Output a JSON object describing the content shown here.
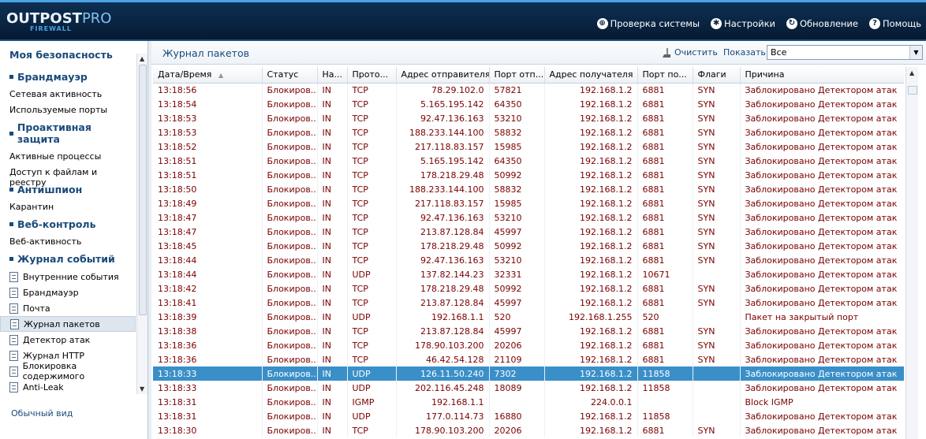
{
  "app": {
    "logo_main": "OUTPOST",
    "logo_pro": "PRO",
    "logo_sub": "FIREWALL"
  },
  "topnav": [
    {
      "label": "Проверка системы",
      "icon": "scan-icon"
    },
    {
      "label": "Настройки",
      "icon": "gear-icon"
    },
    {
      "label": "Обновление",
      "icon": "update-icon"
    },
    {
      "label": "Помощь",
      "icon": "help-icon"
    }
  ],
  "sidebar": {
    "sections": [
      {
        "title": "Моя безопасность",
        "items": []
      },
      {
        "title": "Брандмауэр",
        "items": [
          "Сетевая активность",
          "Используемые порты"
        ]
      },
      {
        "title": "Проактивная защита",
        "items": [
          "Активные процессы",
          "Доступ к файлам и реестру"
        ]
      },
      {
        "title": "Антишпион",
        "items": [
          "Карантин"
        ]
      },
      {
        "title": "Веб-контроль",
        "items": [
          "Веб-активность"
        ]
      },
      {
        "title": "Журнал событий",
        "items": [
          "Внутренние события",
          "Брандмауэр",
          "Почта",
          "Журнал пакетов",
          "Детектор атак",
          "Журнал HTTP",
          "Блокировка содержимого",
          "Anti-Leak"
        ]
      }
    ],
    "normal_view": "Обычный вид"
  },
  "toolbar": {
    "title": "Журнал пакетов",
    "clear": "Очистить",
    "show_label": "Показать:",
    "show_value": "Все"
  },
  "table": {
    "headers": [
      "Дата/Время",
      "Статус",
      "На...",
      "Прото...",
      "Адрес отправителя",
      "Порт отп...",
      "Адрес получателя",
      "Порт по...",
      "Флаги",
      "Причина"
    ],
    "selected_index": 20,
    "rows": [
      [
        "13:18:56",
        "Блокиров...",
        "IN",
        "TCP",
        "78.29.102.0",
        "57821",
        "192.168.1.2",
        "6881",
        "SYN",
        "Заблокировано Детектором атак"
      ],
      [
        "13:18:54",
        "Блокиров...",
        "IN",
        "TCP",
        "5.165.195.142",
        "64350",
        "192.168.1.2",
        "6881",
        "SYN",
        "Заблокировано Детектором атак"
      ],
      [
        "13:18:53",
        "Блокиров...",
        "IN",
        "TCP",
        "92.47.136.163",
        "53210",
        "192.168.1.2",
        "6881",
        "SYN",
        "Заблокировано Детектором атак"
      ],
      [
        "13:18:53",
        "Блокиров...",
        "IN",
        "TCP",
        "188.233.144.100",
        "58832",
        "192.168.1.2",
        "6881",
        "SYN",
        "Заблокировано Детектором атак"
      ],
      [
        "13:18:52",
        "Блокиров...",
        "IN",
        "TCP",
        "217.118.83.157",
        "15985",
        "192.168.1.2",
        "6881",
        "SYN",
        "Заблокировано Детектором атак"
      ],
      [
        "13:18:51",
        "Блокиров...",
        "IN",
        "TCP",
        "5.165.195.142",
        "64350",
        "192.168.1.2",
        "6881",
        "SYN",
        "Заблокировано Детектором атак"
      ],
      [
        "13:18:51",
        "Блокиров...",
        "IN",
        "TCP",
        "178.218.29.48",
        "50992",
        "192.168.1.2",
        "6881",
        "SYN",
        "Заблокировано Детектором атак"
      ],
      [
        "13:18:50",
        "Блокиров...",
        "IN",
        "TCP",
        "188.233.144.100",
        "58832",
        "192.168.1.2",
        "6881",
        "SYN",
        "Заблокировано Детектором атак"
      ],
      [
        "13:18:49",
        "Блокиров...",
        "IN",
        "TCP",
        "217.118.83.157",
        "15985",
        "192.168.1.2",
        "6881",
        "SYN",
        "Заблокировано Детектором атак"
      ],
      [
        "13:18:47",
        "Блокиров...",
        "IN",
        "TCP",
        "92.47.136.163",
        "53210",
        "192.168.1.2",
        "6881",
        "SYN",
        "Заблокировано Детектором атак"
      ],
      [
        "13:18:47",
        "Блокиров...",
        "IN",
        "TCP",
        "213.87.128.84",
        "45997",
        "192.168.1.2",
        "6881",
        "SYN",
        "Заблокировано Детектором атак"
      ],
      [
        "13:18:45",
        "Блокиров...",
        "IN",
        "TCP",
        "178.218.29.48",
        "50992",
        "192.168.1.2",
        "6881",
        "SYN",
        "Заблокировано Детектором атак"
      ],
      [
        "13:18:44",
        "Блокиров...",
        "IN",
        "TCP",
        "92.47.136.163",
        "53210",
        "192.168.1.2",
        "6881",
        "SYN",
        "Заблокировано Детектором атак"
      ],
      [
        "13:18:44",
        "Блокиров...",
        "IN",
        "UDP",
        "137.82.144.23",
        "32331",
        "192.168.1.2",
        "10671",
        "",
        "Заблокировано Детектором атак"
      ],
      [
        "13:18:42",
        "Блокиров...",
        "IN",
        "TCP",
        "178.218.29.48",
        "50992",
        "192.168.1.2",
        "6881",
        "SYN",
        "Заблокировано Детектором атак"
      ],
      [
        "13:18:41",
        "Блокиров...",
        "IN",
        "TCP",
        "213.87.128.84",
        "45997",
        "192.168.1.2",
        "6881",
        "SYN",
        "Заблокировано Детектором атак"
      ],
      [
        "13:18:39",
        "Блокиров...",
        "IN",
        "UDP",
        "192.168.1.1",
        "520",
        "192.168.1.255",
        "520",
        "",
        "Пакет на закрытый порт"
      ],
      [
        "13:18:38",
        "Блокиров...",
        "IN",
        "TCP",
        "213.87.128.84",
        "45997",
        "192.168.1.2",
        "6881",
        "SYN",
        "Заблокировано Детектором атак"
      ],
      [
        "13:18:36",
        "Блокиров...",
        "IN",
        "TCP",
        "178.90.103.200",
        "20206",
        "192.168.1.2",
        "6881",
        "SYN",
        "Заблокировано Детектором атак"
      ],
      [
        "13:18:36",
        "Блокиров...",
        "IN",
        "TCP",
        "46.42.54.128",
        "21109",
        "192.168.1.2",
        "6881",
        "SYN",
        "Заблокировано Детектором атак"
      ],
      [
        "13:18:33",
        "Блокиров...",
        "IN",
        "UDP",
        "126.11.50.240",
        "7302",
        "192.168.1.2",
        "11858",
        "",
        "Заблокировано Детектором атак"
      ],
      [
        "13:18:33",
        "Блокиров...",
        "IN",
        "UDP",
        "202.116.45.248",
        "18089",
        "192.168.1.2",
        "11858",
        "",
        "Заблокировано Детектором атак"
      ],
      [
        "13:18:31",
        "Блокиров...",
        "IN",
        "IGMP",
        "192.168.1.1",
        "",
        "224.0.0.1",
        "",
        "",
        "Block IGMP"
      ],
      [
        "13:18:31",
        "Блокиров...",
        "IN",
        "UDP",
        "177.0.114.73",
        "16880",
        "192.168.1.2",
        "11858",
        "",
        "Заблокировано Детектором атак"
      ],
      [
        "13:18:30",
        "Блокиров...",
        "IN",
        "TCP",
        "178.90.103.200",
        "20206",
        "192.168.1.2",
        "6881",
        "SYN",
        "Заблокировано Детектором атак"
      ]
    ]
  }
}
